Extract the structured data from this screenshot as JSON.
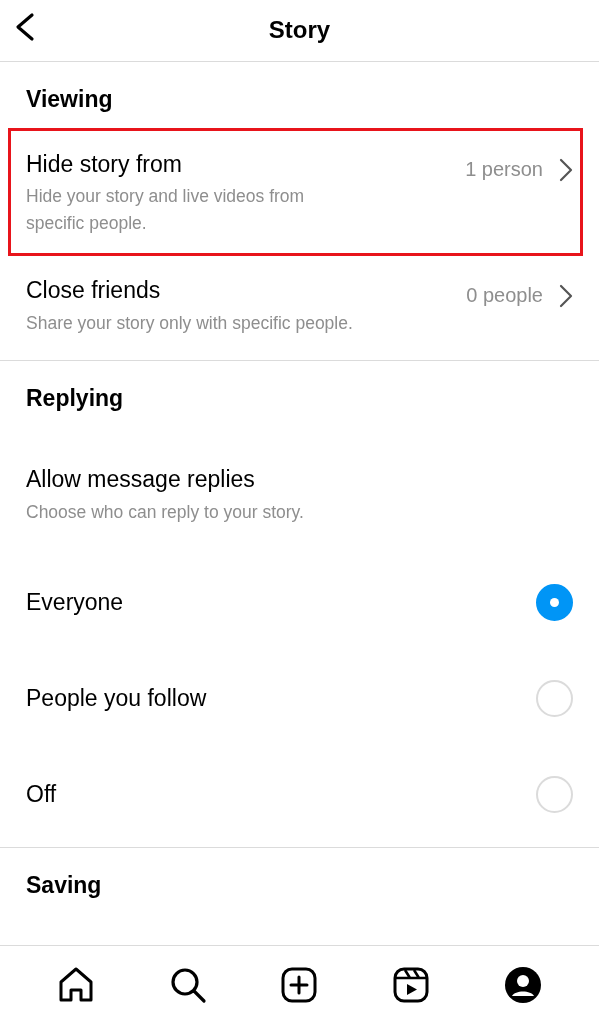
{
  "header": {
    "title": "Story"
  },
  "sections": [
    {
      "title": "Viewing",
      "items": [
        {
          "kind": "link",
          "label": "Hide story from",
          "value": "1 person",
          "description": "Hide your story and live videos from specific people.",
          "highlighted": true
        },
        {
          "kind": "link",
          "label": "Close friends",
          "value": "0 people",
          "description": "Share your story only with specific people.",
          "highlighted": false
        }
      ]
    },
    {
      "title": "Replying",
      "items": [
        {
          "kind": "info",
          "label": "Allow message replies",
          "description": "Choose who can reply to your story."
        },
        {
          "kind": "radio",
          "label": "Everyone",
          "selected": true
        },
        {
          "kind": "radio",
          "label": "People you follow",
          "selected": false
        },
        {
          "kind": "radio",
          "label": "Off",
          "selected": false
        }
      ]
    },
    {
      "title": "Saving"
    }
  ]
}
